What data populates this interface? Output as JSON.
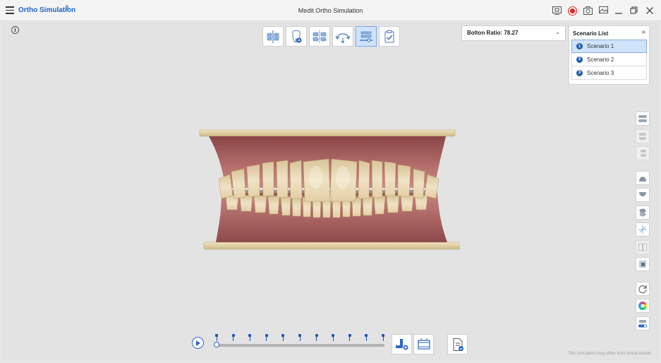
{
  "titlebar": {
    "app_name": "Ortho Simulation",
    "app_badge": "β",
    "window_title": "Medit Ortho Simulation"
  },
  "bolton": {
    "label": "Bolton Ratio: 78.27"
  },
  "scenarios": {
    "title": "Scenario List",
    "items": [
      {
        "number": "1",
        "label": "Scenario 1",
        "selected": true
      },
      {
        "number": "2",
        "label": "Scenario 2",
        "selected": false
      },
      {
        "number": "3",
        "label": "Scenario 3",
        "selected": false
      }
    ]
  },
  "timeline": {
    "stage_count": 11,
    "current_stage_fraction": 0
  },
  "disclaimer": "This simulation may differ from actual results.",
  "colors": {
    "accent": "#1a66c8",
    "active_bg": "#cfe3fb",
    "record": "#e02424",
    "gum": "#b06462",
    "tooth": "#ead9ba",
    "base": "#e6d6aa"
  }
}
